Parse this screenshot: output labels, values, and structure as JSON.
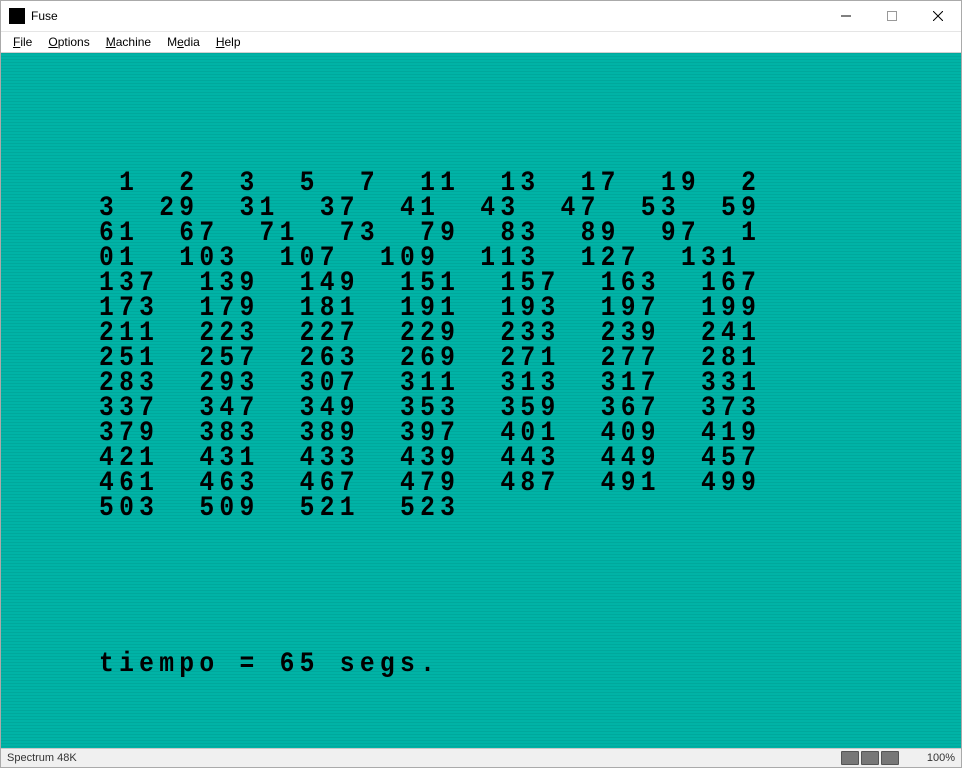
{
  "window": {
    "title": "Fuse",
    "icon_name": "fuse-app-icon"
  },
  "menus": {
    "file": {
      "label": "File",
      "underline_index": 0
    },
    "options": {
      "label": "Options",
      "underline_index": 0
    },
    "machine": {
      "label": "Machine",
      "underline_index": 0
    },
    "media": {
      "label": "Media",
      "underline_index": 1
    },
    "help": {
      "label": "Help",
      "underline_index": 0
    }
  },
  "spectrum": {
    "primes_text": " 1  2  3  5  7  11  13  17  19  23  29  31  37  41  43  47  53  59  61  67  71  73  79  83  89  97  101  103  107  109  113  127  131  137  139  149  151  157  163  167  173  179  181  191  193  197  199  211  223  227  229  233  239  241  251  257  263  269  271  277  281  283  293  307  311  313  317  331  337  347  349  353  359  367  373  379  383  389  397  401  409  419  421  431  433  439  443  449  457  461  463  467  479  487  491  499  503  509  521  523 ",
    "status_line": "tiempo = 65 segs."
  },
  "statusbar": {
    "machine": "Spectrum 48K",
    "speed": "100%"
  },
  "colors": {
    "zx_cyan": "#00B3A6"
  }
}
